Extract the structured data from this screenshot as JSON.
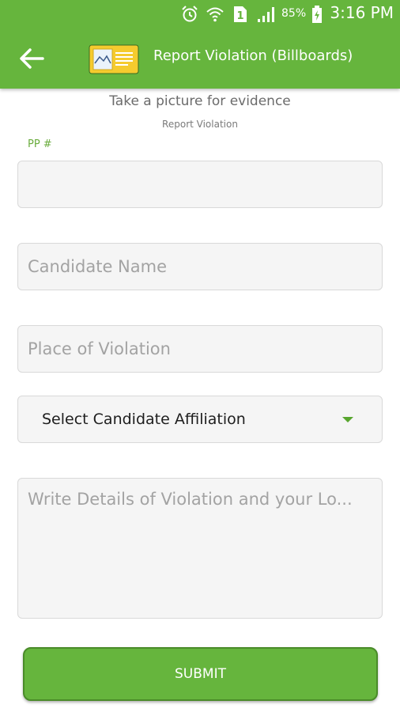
{
  "status_bar": {
    "battery_percent": "85%",
    "time": "3:16 PM",
    "icons": [
      "alarm-icon",
      "wifi-icon",
      "sim-icon",
      "signal-icon",
      "battery-icon"
    ]
  },
  "toolbar": {
    "title": "Report Violation (Billboards)",
    "back_icon": "arrow-left-icon",
    "logo_icon": "billboard-logo-icon"
  },
  "form": {
    "hint": "Take a picture for evidence",
    "subhint": "Report Violation",
    "pp_label": "PP #",
    "pp_value": "",
    "candidate_name_placeholder": "Candidate Name",
    "place_placeholder": "Place of Violation",
    "affiliation_selected": "Select Candidate Affiliation",
    "details_placeholder": "Write Details of Violation and your Lo...",
    "submit_label": "SUBMIT"
  },
  "colors": {
    "primary": "#66b53d",
    "accent_label": "#6aac3d",
    "logo_yellow": "#f5cb2e"
  }
}
